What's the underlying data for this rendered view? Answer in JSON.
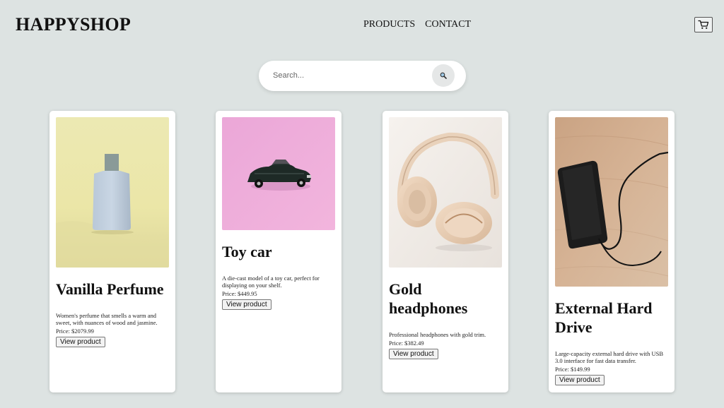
{
  "header": {
    "brand": "HAPPYSHOP",
    "nav": [
      {
        "label": "PRODUCTS"
      },
      {
        "label": "CONTACT"
      }
    ],
    "cart_icon": "shopping-cart-icon"
  },
  "search": {
    "placeholder": "Search...",
    "value": "",
    "icon": "magnifier-icon"
  },
  "products": [
    {
      "name": "Vanilla Perfume",
      "description": "Women's perfume that smells a warm and sweet, with nuances of wood and jasmine.",
      "price": "Price: $2079.99",
      "button": "View product"
    },
    {
      "name": "Toy car",
      "description": "A die-cast model of a toy car, perfect for displaying on your shelf.",
      "price": "Price: $449.95",
      "button": "View product"
    },
    {
      "name": "Gold headphones",
      "description": "Professional headphones with gold trim.",
      "price": "Price: $382.49",
      "button": "View product"
    },
    {
      "name": "External Hard Drive",
      "description": "Large-capacity external hard drive with USB 3.0 interface for fast data transfer.",
      "price": "Price: $149.99",
      "button": "View product"
    }
  ],
  "colors": {
    "background": "#dde3e2",
    "card": "#ffffff"
  }
}
